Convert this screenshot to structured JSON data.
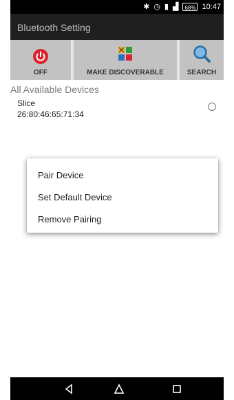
{
  "status_bar": {
    "time": "10:47",
    "battery": "68%",
    "icons": [
      "bluetooth-icon",
      "alarm-icon",
      "sim-icon",
      "signal-icon",
      "battery-icon"
    ]
  },
  "app_bar": {
    "title": "Bluetooth Setting"
  },
  "actions": [
    {
      "label": "OFF",
      "icon": "power-icon",
      "icon_color": "#d9242c"
    },
    {
      "label": "MAKE DISCOVERABLE",
      "icon": "discoverable-grid-icon"
    },
    {
      "label": "SEARCH",
      "icon": "search-icon",
      "icon_color": "#2a6fa3"
    }
  ],
  "devices_section": {
    "title": "All Available Devices",
    "devices": [
      {
        "name": "Slice",
        "mac": "26:80:46:65:71:34",
        "selected": false
      }
    ]
  },
  "context_menu": {
    "items": [
      "Pair Device",
      "Set Default Device",
      "Remove Pairing"
    ]
  },
  "nav": [
    "back-icon",
    "home-icon",
    "recent-apps-icon"
  ]
}
